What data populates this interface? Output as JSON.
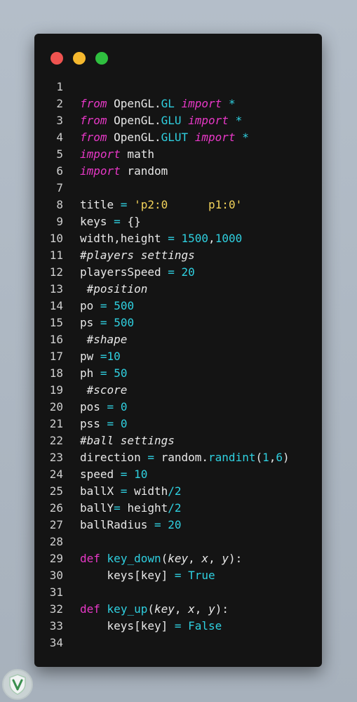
{
  "window": {
    "traffic_lights": [
      {
        "name": "close",
        "color": "#ef5350"
      },
      {
        "name": "minimize",
        "color": "#f5b82e"
      },
      {
        "name": "maximize",
        "color": "#2fbf3f"
      }
    ]
  },
  "colors": {
    "keyword": "#e838c7",
    "module": "#2fd0e0",
    "number": "#2fd0e0",
    "string": "#f3d35a",
    "plain": "#e8e8e8",
    "background": "#141414"
  },
  "code": {
    "lines": [
      {
        "n": "1",
        "tokens": []
      },
      {
        "n": "2",
        "tokens": [
          [
            "kw",
            "from"
          ],
          [
            "plain",
            " OpenGL."
          ],
          [
            "mod",
            "GL"
          ],
          [
            "plain",
            " "
          ],
          [
            "kw",
            "import"
          ],
          [
            "plain",
            " "
          ],
          [
            "op",
            "*"
          ]
        ]
      },
      {
        "n": "3",
        "tokens": [
          [
            "kw",
            "from"
          ],
          [
            "plain",
            " OpenGL."
          ],
          [
            "mod",
            "GLU"
          ],
          [
            "plain",
            " "
          ],
          [
            "kw",
            "import"
          ],
          [
            "plain",
            " "
          ],
          [
            "op",
            "*"
          ]
        ]
      },
      {
        "n": "4",
        "tokens": [
          [
            "kw",
            "from"
          ],
          [
            "plain",
            " OpenGL."
          ],
          [
            "mod",
            "GLUT"
          ],
          [
            "plain",
            " "
          ],
          [
            "kw",
            "import"
          ],
          [
            "plain",
            " "
          ],
          [
            "op",
            "*"
          ]
        ]
      },
      {
        "n": "5",
        "tokens": [
          [
            "kw",
            "import"
          ],
          [
            "plain",
            " math"
          ]
        ]
      },
      {
        "n": "6",
        "tokens": [
          [
            "kw",
            "import"
          ],
          [
            "plain",
            " random"
          ]
        ]
      },
      {
        "n": "7",
        "tokens": []
      },
      {
        "n": "8",
        "tokens": [
          [
            "plain",
            "title "
          ],
          [
            "op",
            "="
          ],
          [
            "plain",
            " "
          ],
          [
            "str",
            "'p2:0      p1:0'"
          ]
        ]
      },
      {
        "n": "9",
        "tokens": [
          [
            "plain",
            "keys "
          ],
          [
            "op",
            "="
          ],
          [
            "plain",
            " {}"
          ]
        ]
      },
      {
        "n": "10",
        "tokens": [
          [
            "plain",
            "width,height "
          ],
          [
            "op",
            "="
          ],
          [
            "plain",
            " "
          ],
          [
            "num",
            "1500"
          ],
          [
            "plain",
            ","
          ],
          [
            "num",
            "1000"
          ]
        ]
      },
      {
        "n": "11",
        "tokens": [
          [
            "com",
            "#players settings"
          ]
        ]
      },
      {
        "n": "12",
        "tokens": [
          [
            "plain",
            "playersSpeed "
          ],
          [
            "op",
            "="
          ],
          [
            "plain",
            " "
          ],
          [
            "num",
            "20"
          ]
        ]
      },
      {
        "n": "13",
        "tokens": [
          [
            "plain",
            " "
          ],
          [
            "com",
            "#position"
          ]
        ]
      },
      {
        "n": "14",
        "tokens": [
          [
            "plain",
            "po "
          ],
          [
            "op",
            "="
          ],
          [
            "plain",
            " "
          ],
          [
            "num",
            "500"
          ]
        ]
      },
      {
        "n": "15",
        "tokens": [
          [
            "plain",
            "ps "
          ],
          [
            "op",
            "="
          ],
          [
            "plain",
            " "
          ],
          [
            "num",
            "500"
          ]
        ]
      },
      {
        "n": "16",
        "tokens": [
          [
            "plain",
            " "
          ],
          [
            "com",
            "#shape"
          ]
        ]
      },
      {
        "n": "17",
        "tokens": [
          [
            "plain",
            "pw "
          ],
          [
            "op",
            "="
          ],
          [
            "num",
            "10"
          ]
        ]
      },
      {
        "n": "18",
        "tokens": [
          [
            "plain",
            "ph "
          ],
          [
            "op",
            "="
          ],
          [
            "plain",
            " "
          ],
          [
            "num",
            "50"
          ]
        ]
      },
      {
        "n": "19",
        "tokens": [
          [
            "plain",
            " "
          ],
          [
            "com",
            "#score"
          ]
        ]
      },
      {
        "n": "20",
        "tokens": [
          [
            "plain",
            "pos "
          ],
          [
            "op",
            "="
          ],
          [
            "plain",
            " "
          ],
          [
            "num",
            "0"
          ]
        ]
      },
      {
        "n": "21",
        "tokens": [
          [
            "plain",
            "pss "
          ],
          [
            "op",
            "="
          ],
          [
            "plain",
            " "
          ],
          [
            "num",
            "0"
          ]
        ]
      },
      {
        "n": "22",
        "tokens": [
          [
            "com",
            "#ball settings"
          ]
        ]
      },
      {
        "n": "23",
        "tokens": [
          [
            "plain",
            "direction "
          ],
          [
            "op",
            "="
          ],
          [
            "plain",
            " random."
          ],
          [
            "fn",
            "randint"
          ],
          [
            "plain",
            "("
          ],
          [
            "num",
            "1"
          ],
          [
            "plain",
            ","
          ],
          [
            "num",
            "6"
          ],
          [
            "plain",
            ")"
          ]
        ]
      },
      {
        "n": "24",
        "tokens": [
          [
            "plain",
            "speed "
          ],
          [
            "op",
            "="
          ],
          [
            "plain",
            " "
          ],
          [
            "num",
            "10"
          ]
        ]
      },
      {
        "n": "25",
        "tokens": [
          [
            "plain",
            "ballX "
          ],
          [
            "op",
            "="
          ],
          [
            "plain",
            " width"
          ],
          [
            "op",
            "/"
          ],
          [
            "num",
            "2"
          ]
        ]
      },
      {
        "n": "26",
        "tokens": [
          [
            "plain",
            "ballY"
          ],
          [
            "op",
            "="
          ],
          [
            "plain",
            " height"
          ],
          [
            "op",
            "/"
          ],
          [
            "num",
            "2"
          ]
        ]
      },
      {
        "n": "27",
        "tokens": [
          [
            "plain",
            "ballRadius "
          ],
          [
            "op",
            "="
          ],
          [
            "plain",
            " "
          ],
          [
            "num",
            "20"
          ]
        ]
      },
      {
        "n": "28",
        "tokens": []
      },
      {
        "n": "29",
        "tokens": [
          [
            "kwd",
            "def"
          ],
          [
            "plain",
            " "
          ],
          [
            "fn",
            "key_down"
          ],
          [
            "plain",
            "("
          ],
          [
            "param",
            "key"
          ],
          [
            "plain",
            ", "
          ],
          [
            "param",
            "x"
          ],
          [
            "plain",
            ", "
          ],
          [
            "param",
            "y"
          ],
          [
            "plain",
            "):"
          ]
        ]
      },
      {
        "n": "30",
        "tokens": [
          [
            "plain",
            "    keys[key] "
          ],
          [
            "op",
            "="
          ],
          [
            "plain",
            " "
          ],
          [
            "const",
            "True"
          ]
        ]
      },
      {
        "n": "31",
        "tokens": []
      },
      {
        "n": "32",
        "tokens": [
          [
            "kwd",
            "def"
          ],
          [
            "plain",
            " "
          ],
          [
            "fn",
            "key_up"
          ],
          [
            "plain",
            "("
          ],
          [
            "param",
            "key"
          ],
          [
            "plain",
            ", "
          ],
          [
            "param",
            "x"
          ],
          [
            "plain",
            ", "
          ],
          [
            "param",
            "y"
          ],
          [
            "plain",
            "):"
          ]
        ]
      },
      {
        "n": "33",
        "tokens": [
          [
            "plain",
            "    keys[key] "
          ],
          [
            "op",
            "="
          ],
          [
            "plain",
            " "
          ],
          [
            "const",
            "False"
          ]
        ]
      },
      {
        "n": "34",
        "tokens": []
      }
    ]
  },
  "watermark": {
    "icon": "shield-v-logo-icon"
  }
}
